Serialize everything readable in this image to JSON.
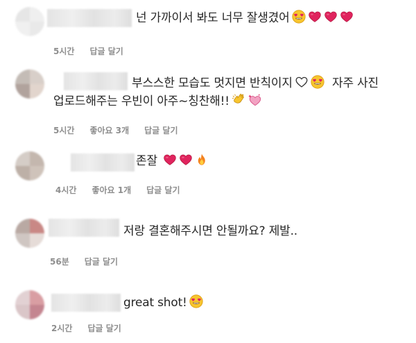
{
  "comments": [
    {
      "text": "넌 가까이서 봐도 너무 잘생겼어",
      "time": "5시간",
      "likes": "",
      "reply": "답글 달기",
      "emojis": [
        "heart-eyes-emoji",
        "red-heart-emoji",
        "red-heart-emoji",
        "red-heart-emoji"
      ]
    },
    {
      "text_line1": "부스스한 모습도 멋지면 반칙이지",
      "text_line1_tail": "자주 사진",
      "text_line2": "업로드해주는 우빈이 아주~칭찬해!!",
      "time": "5시간",
      "likes": "좋아요 3개",
      "reply": "답글 달기",
      "emojis": [
        "white-heart-emoji",
        "heart-eyes-emoji",
        "clapping-hands-emoji",
        "sparkling-heart-emoji"
      ]
    },
    {
      "text": "존잘",
      "time": "4시간",
      "likes": "좋아요 1개",
      "reply": "답글 달기",
      "emojis": [
        "red-heart-emoji",
        "red-heart-emoji",
        "fire-emoji"
      ]
    },
    {
      "text": "저랑 결혼해주시면 안될까요? 제발..",
      "time": "56분",
      "likes": "",
      "reply": "답글 달기",
      "emojis": []
    },
    {
      "text": "great shot!",
      "time": "2시간",
      "likes": "",
      "reply": "답글 달기",
      "emojis": [
        "heart-eyes-emoji"
      ]
    }
  ],
  "colors": {
    "text": "#262626",
    "meta": "#8e8e8e",
    "heart": "#e0245e",
    "face": "#f7c52f"
  }
}
